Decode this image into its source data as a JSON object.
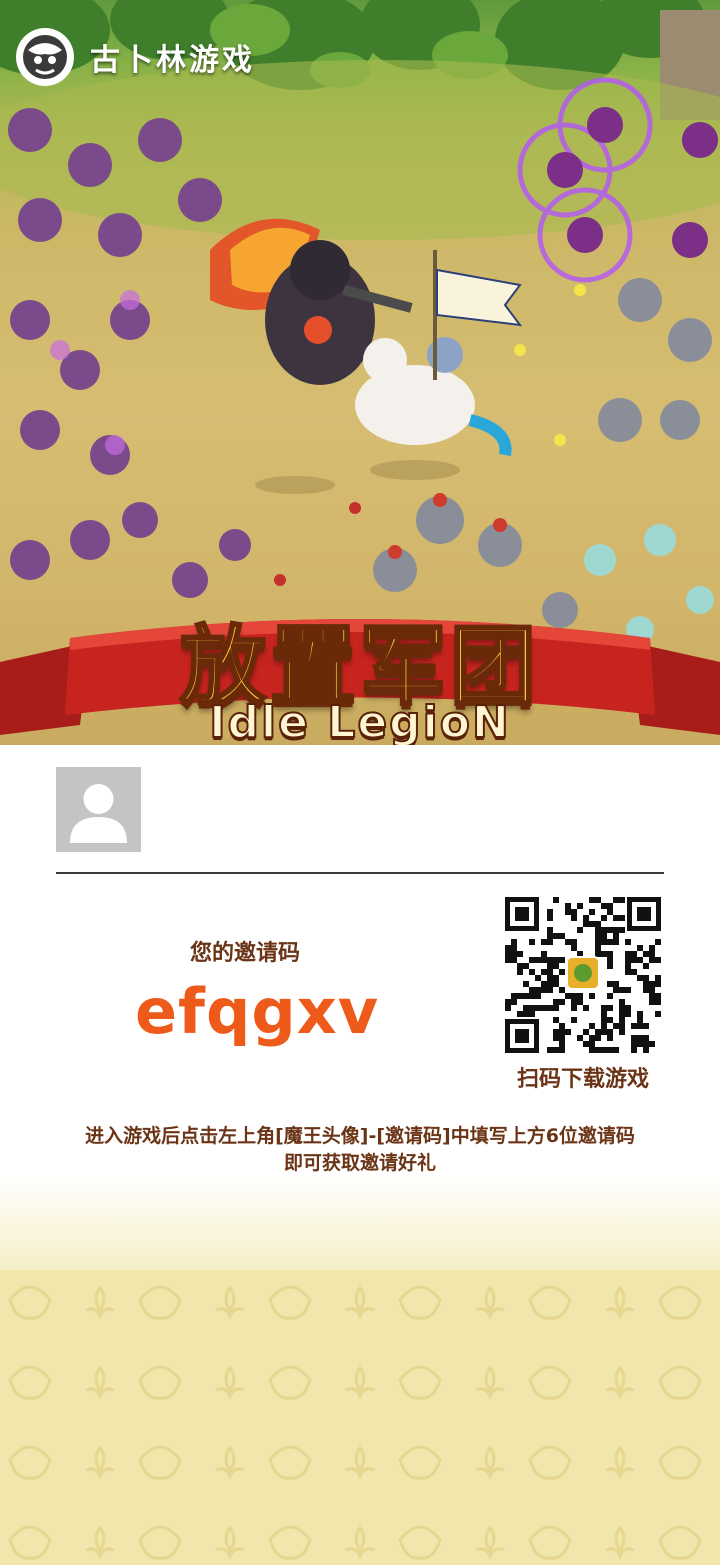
{
  "brand": {
    "name": "古卜林游戏",
    "logo_icon": "goblin-head-icon"
  },
  "game": {
    "title_cn": "放置军团",
    "title_en": "Idle LegioN"
  },
  "profile": {
    "avatar_icon": "default-avatar-icon"
  },
  "invite": {
    "label": "您的邀请码",
    "code": "efqgxv"
  },
  "qr": {
    "label": "扫码下载游戏",
    "icon": "qr-code-icon"
  },
  "instructions": {
    "line1": "进入游戏后点击左上角[魔王头像]-[邀请码]中填写上方6位邀请码",
    "line2": "即可获取邀请好礼"
  },
  "colors": {
    "accent": "#ed5a1a",
    "text_brown": "#6b3416",
    "footer_bg": "#f1e7ad",
    "banner_red": "#c8241f"
  }
}
